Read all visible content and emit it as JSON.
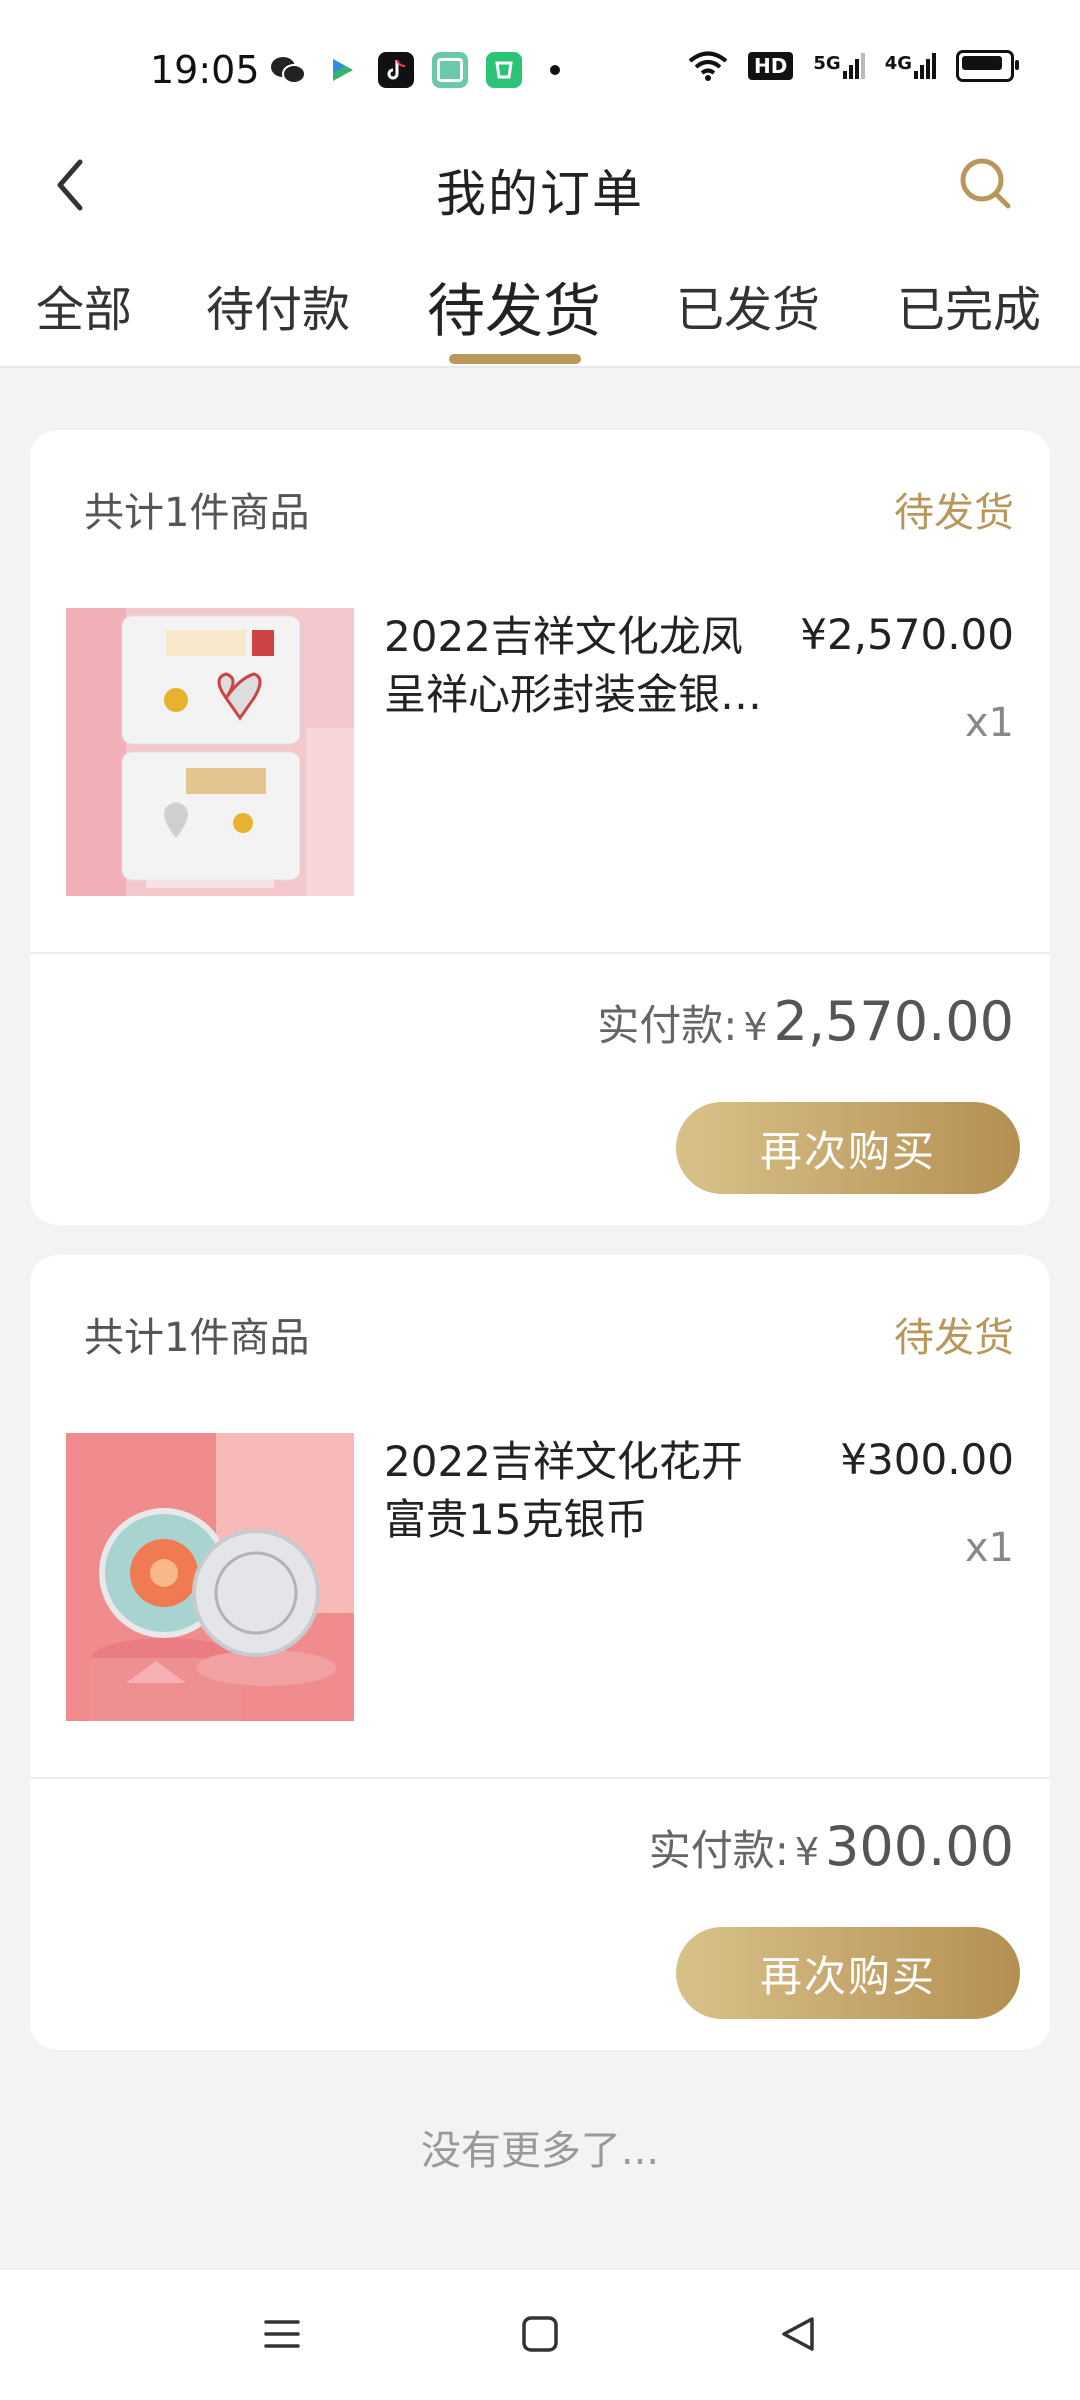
{
  "status_bar": {
    "time": "19:05",
    "right_text_hd": "HD",
    "right_text_5g": "5G",
    "right_text_4g": "4G"
  },
  "nav": {
    "title": "我的订单",
    "back_icon": "chevron-left-icon",
    "search_icon": "search-icon",
    "accent_color": "#b9965a"
  },
  "tabs": [
    {
      "label": "全部"
    },
    {
      "label": "待付款"
    },
    {
      "label": "待发货",
      "active": true
    },
    {
      "label": "已发货"
    },
    {
      "label": "已完成"
    }
  ],
  "orders": [
    {
      "count_text": "共计1件商品",
      "status": "待发货",
      "name": "2022吉祥文化龙凤呈祥心形封装金银…",
      "price": "¥2,570.00",
      "qty": "x1",
      "paid_label": "实付款:",
      "paid_currency": "¥",
      "paid_amount": "2,570.00",
      "rebuy_label": "再次购买"
    },
    {
      "count_text": "共计1件商品",
      "status": "待发货",
      "name": "2022吉祥文化花开富贵15克银币",
      "price": "¥300.00",
      "qty": "x1",
      "paid_label": "实付款:",
      "paid_currency": "¥",
      "paid_amount": "300.00",
      "rebuy_label": "再次购买"
    }
  ],
  "footer_text": "没有更多了...",
  "bottom_nav": {
    "menu_icon": "menu-icon",
    "home_icon": "home-square-icon",
    "back_icon": "back-triangle-icon"
  }
}
